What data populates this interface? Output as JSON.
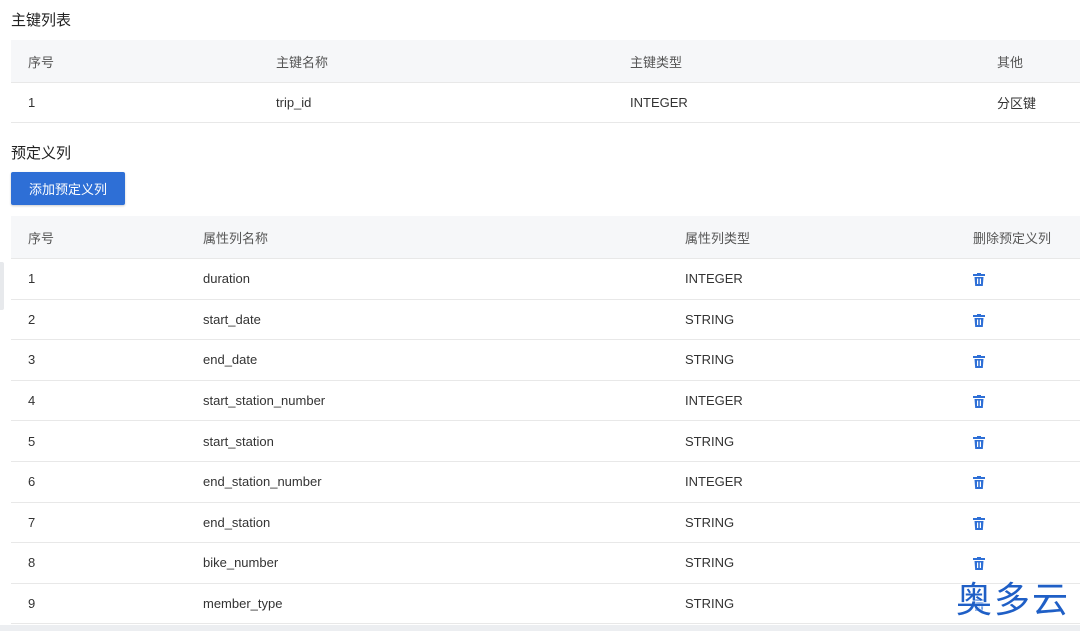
{
  "primary_keys": {
    "title": "主键列表",
    "headers": [
      "序号",
      "主键名称",
      "主键类型",
      "其他"
    ],
    "rows": [
      {
        "index": "1",
        "name": "trip_id",
        "type": "INTEGER",
        "other": "分区键"
      }
    ]
  },
  "predefined_columns": {
    "title": "预定义列",
    "add_button": "添加预定义列",
    "headers": [
      "序号",
      "属性列名称",
      "属性列类型",
      "删除预定义列"
    ],
    "rows": [
      {
        "index": "1",
        "name": "duration",
        "type": "INTEGER"
      },
      {
        "index": "2",
        "name": "start_date",
        "type": "STRING"
      },
      {
        "index": "3",
        "name": "end_date",
        "type": "STRING"
      },
      {
        "index": "4",
        "name": "start_station_number",
        "type": "INTEGER"
      },
      {
        "index": "5",
        "name": "start_station",
        "type": "STRING"
      },
      {
        "index": "6",
        "name": "end_station_number",
        "type": "INTEGER"
      },
      {
        "index": "7",
        "name": "end_station",
        "type": "STRING"
      },
      {
        "index": "8",
        "name": "bike_number",
        "type": "STRING"
      },
      {
        "index": "9",
        "name": "member_type",
        "type": "STRING"
      }
    ],
    "delete_icon": "trash-icon"
  },
  "watermark": "奥多云",
  "colors": {
    "accent": "#2e6fd6",
    "header_bg": "#f6f7f9",
    "border": "#e8e8e8"
  }
}
